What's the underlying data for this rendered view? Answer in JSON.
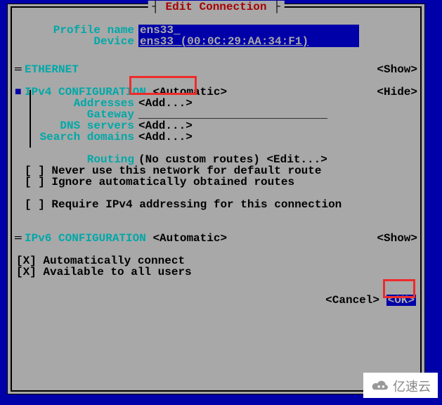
{
  "title": "Edit Connection",
  "fields": {
    "profile_label": "Profile name",
    "profile_value": "ens33",
    "device_label": "Device",
    "device_value": "ens33 (00:0C:29:AA:34:F1)"
  },
  "ethernet": {
    "label": "ETHERNET",
    "toggle": "<Show>"
  },
  "ipv4": {
    "label": "IPv4 CONFIGURATION",
    "mode": "<Automatic>",
    "toggle": "<Hide>",
    "addresses_label": "Addresses",
    "addresses_action": "<Add...>",
    "gateway_label": "Gateway",
    "gateway_value": "____________________________",
    "dns_label": "DNS servers",
    "dns_action": "<Add...>",
    "search_label": "Search domains",
    "search_action": "<Add...>",
    "routing_label": "Routing",
    "routing_status": "(No custom routes)",
    "routing_edit": "<Edit...>",
    "cb_never_default": "[ ] Never use this network for default route",
    "cb_ignore_auto": "[ ] Ignore automatically obtained routes",
    "cb_require": "[ ] Require IPv4 addressing for this connection"
  },
  "ipv6": {
    "label": "IPv6 CONFIGURATION",
    "mode": "<Automatic>",
    "toggle": "<Show>"
  },
  "footer": {
    "cb_autoconnect": "[X] Automatically connect",
    "cb_allusers": "[X] Available to all users",
    "cancel": "<Cancel>",
    "ok": "<OK>"
  },
  "watermark": "亿速云"
}
